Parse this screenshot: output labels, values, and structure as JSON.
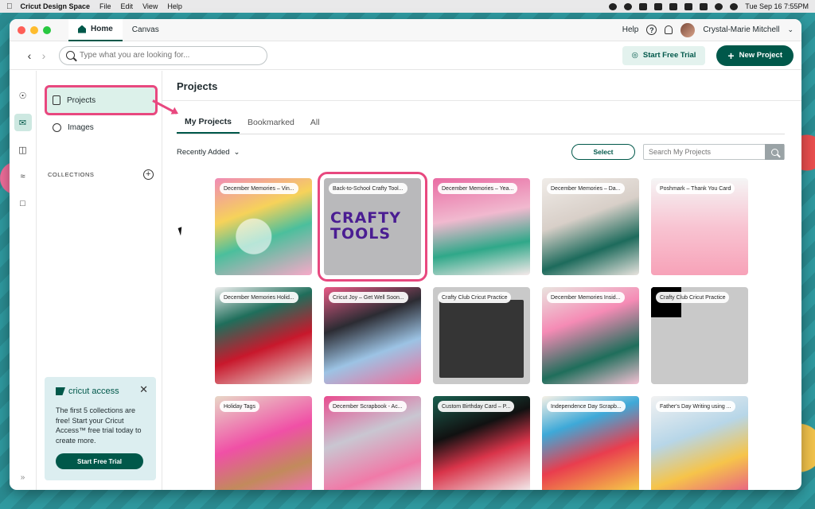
{
  "menubar": {
    "app_name": "Cricut Design Space",
    "items": [
      "File",
      "Edit",
      "View",
      "Help"
    ],
    "clock": "Tue Sep 16  7:55PM"
  },
  "window": {
    "tabs": [
      {
        "label": "Home"
      },
      {
        "label": "Canvas"
      }
    ],
    "help_label": "Help",
    "user_name": "Crystal-Marie Mitchell"
  },
  "toolbar": {
    "search_placeholder": "Type what you are looking for...",
    "trial_label": "Start Free Trial",
    "new_project_label": "New Project"
  },
  "sidebar": {
    "items": [
      {
        "label": "Projects"
      },
      {
        "label": "Images"
      }
    ],
    "collections_label": "COLLECTIONS",
    "promo": {
      "brand": "cricut access",
      "text": "The first 5 collections are free! Start your Cricut Access™ free trial today to create more.",
      "button": "Start Free Trial"
    }
  },
  "content": {
    "title": "Projects",
    "tabs": [
      {
        "label": "My Projects"
      },
      {
        "label": "Bookmarked"
      },
      {
        "label": "All"
      }
    ],
    "sort_label": "Recently Added",
    "select_label": "Select",
    "search_placeholder": "Search My Projects",
    "projects": [
      {
        "label": "December Memories – Vin..."
      },
      {
        "label": "Back-to-School Crafty Tool...",
        "art_text": "CRAFTY TOOLS"
      },
      {
        "label": "December Memories – Yea..."
      },
      {
        "label": "December Memories – Da..."
      },
      {
        "label": "Poshmark – Thank You Card"
      },
      {
        "label": "December Memories Holid..."
      },
      {
        "label": "Cricut Joy – Get Well Soon..."
      },
      {
        "label": "Crafty Club Cricut Practice"
      },
      {
        "label": "December Memories Insid..."
      },
      {
        "label": "Crafty Club Cricut Practice"
      },
      {
        "label": "Holiday Tags"
      },
      {
        "label": "December Scrapbook - Ac..."
      },
      {
        "label": "Custom Birthday Card – P..."
      },
      {
        "label": "Independence Day Scrapb..."
      },
      {
        "label": "Father's Day Writing using ..."
      }
    ]
  },
  "colors": {
    "brand_green": "#00584a",
    "highlight_pink": "#e8487f"
  }
}
